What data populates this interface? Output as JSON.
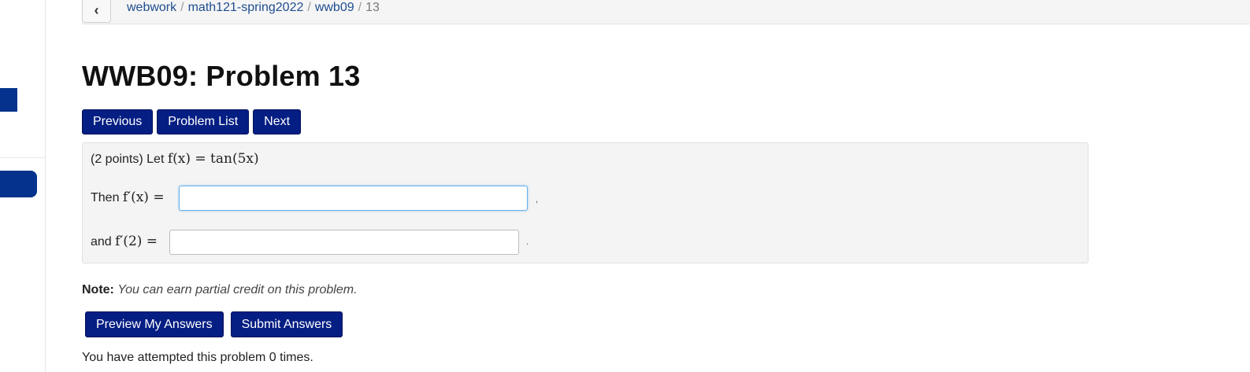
{
  "breadcrumb": {
    "back_icon": "chevron-left-icon",
    "items": [
      "webwork",
      "math121-spring2022",
      "wwb09"
    ],
    "current": "13",
    "separator": "/"
  },
  "page_title": "WWB09: Problem 13",
  "nav": {
    "previous": "Previous",
    "problem_list": "Problem List",
    "next": "Next"
  },
  "problem": {
    "intro": "(2 points) Let",
    "function_expr": "f(x) = tan(5x)",
    "line1_prefix": "Then",
    "line1_math": "f′(x) =",
    "line1_value": "",
    "line1_end": ",",
    "line2_prefix": "and",
    "line2_math": "f′(2) =",
    "line2_value": "",
    "line2_end": "."
  },
  "note": {
    "label": "Note:",
    "text": "You can earn partial credit on this problem."
  },
  "actions": {
    "preview": "Preview My Answers",
    "submit": "Submit Answers"
  },
  "attempts_text": "You have attempted this problem 0 times.",
  "colors": {
    "button_bg": "#051e83",
    "link": "#1f4d8f",
    "rail_accent": "#04328c"
  }
}
